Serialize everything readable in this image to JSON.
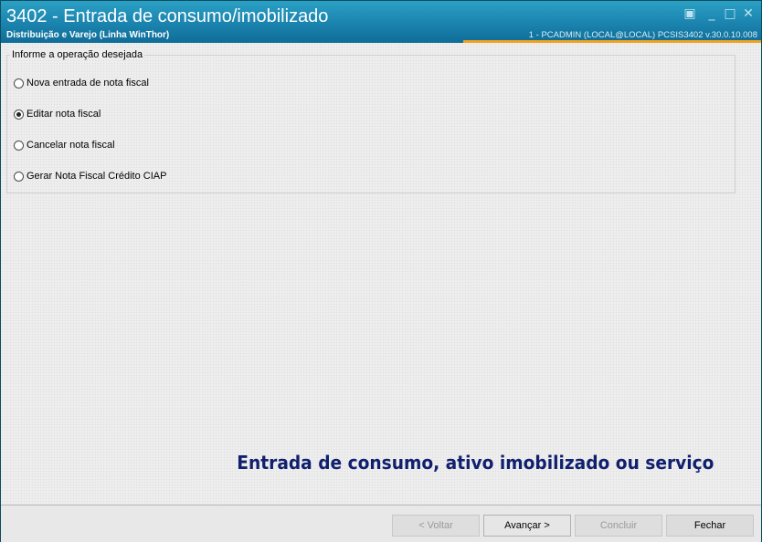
{
  "window": {
    "title": "3402 - Entrada de consumo/imobilizado",
    "subtitle": "Distribuição e Varejo (Linha WinThor)",
    "sysinfo": "1 - PCADMIN (LOCAL@LOCAL)   PCSIS3402  v.30.0.10.008",
    "controls": {
      "restore": "▣",
      "minimize": "_",
      "maximize": "□",
      "close": "✕"
    }
  },
  "operation_group": {
    "legend": "Informe a operação desejada",
    "options": [
      {
        "label": "Nova entrada de nota fiscal",
        "checked": false
      },
      {
        "label": "Editar nota fiscal",
        "checked": true
      },
      {
        "label": "Cancelar nota fiscal",
        "checked": false
      },
      {
        "label": "Gerar Nota Fiscal Crédito CIAP",
        "checked": false
      }
    ]
  },
  "tagline": "Entrada de consumo, ativo imobilizado ou serviço",
  "buttons": {
    "voltar": "< Voltar",
    "avancar": "Avançar >",
    "concluir": "Concluir",
    "fechar": "Fechar"
  },
  "colors": {
    "title_bar": "#1d88b2",
    "accent_line": "#f0a21f",
    "tagline": "#10206e"
  }
}
